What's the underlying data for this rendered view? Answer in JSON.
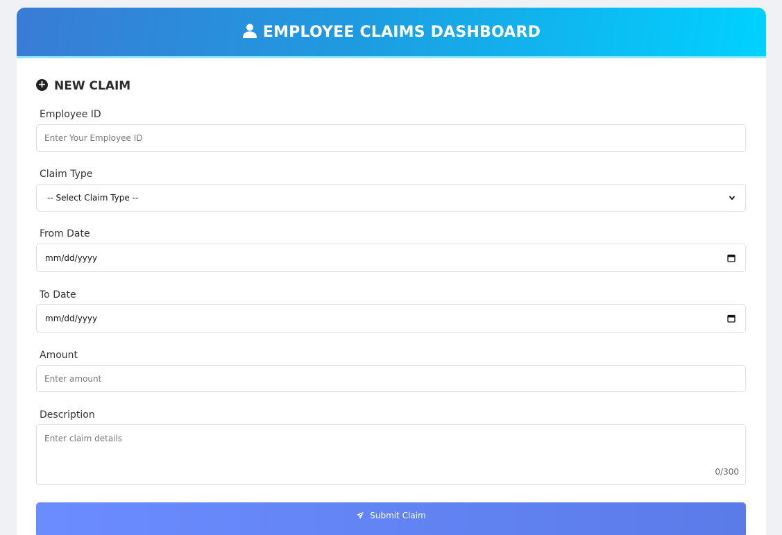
{
  "header": {
    "title": "EMPLOYEE CLAIMS DASHBOARD",
    "icon": "user-icon"
  },
  "section": {
    "title": "NEW CLAIM",
    "icon": "plus-circle-icon"
  },
  "form": {
    "employee_id": {
      "label": "Employee ID",
      "placeholder": "Enter Your Employee ID"
    },
    "claim_type": {
      "label": "Claim Type",
      "selected": "-- Select Claim Type --"
    },
    "from_date": {
      "label": "From Date",
      "value": "mm/dd/yyyy"
    },
    "to_date": {
      "label": "To Date",
      "value": "mm/dd/yyyy"
    },
    "amount": {
      "label": "Amount",
      "placeholder": "Enter amount"
    },
    "description": {
      "label": "Description",
      "placeholder": "Enter claim details",
      "counter": "0/300"
    }
  },
  "submit": {
    "label": "Submit Claim",
    "icon": "paper-plane-icon"
  },
  "colors": {
    "header_start": "#3a7bd5",
    "header_end": "#00d2ff",
    "button": "#6b8cff"
  }
}
